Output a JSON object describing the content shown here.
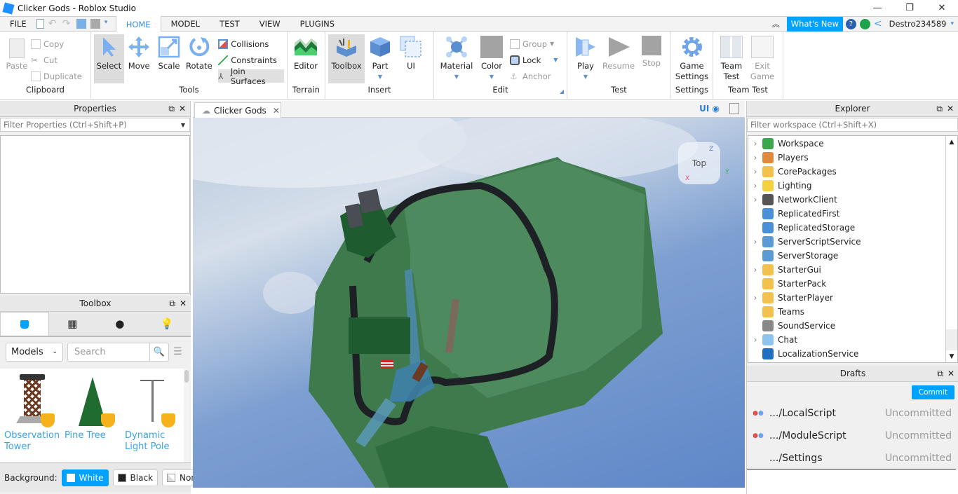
{
  "window": {
    "title": "Clicker Gods - Roblox Studio",
    "controls": [
      "—",
      "❐",
      "✕"
    ]
  },
  "menu": {
    "file": "FILE",
    "tabs": [
      "HOME",
      "MODEL",
      "TEST",
      "VIEW",
      "PLUGINS"
    ],
    "active_tab": "HOME",
    "whats_new": "What's New",
    "username": "Destro234589"
  },
  "ribbon": {
    "clipboard": {
      "label": "Clipboard",
      "paste": "Paste",
      "copy": "Copy",
      "cut": "Cut",
      "duplicate": "Duplicate"
    },
    "tools": {
      "label": "Tools",
      "select": "Select",
      "move": "Move",
      "scale": "Scale",
      "rotate": "Rotate",
      "collisions": "Collisions",
      "constraints": "Constraints",
      "join_surfaces": "Join Surfaces"
    },
    "terrain": {
      "label": "Terrain",
      "editor": "Editor"
    },
    "insert": {
      "label": "Insert",
      "toolbox": "Toolbox",
      "part": "Part",
      "ui": "UI"
    },
    "edit": {
      "label": "Edit",
      "material": "Material",
      "color": "Color",
      "group": "Group",
      "lock": "Lock",
      "anchor": "Anchor"
    },
    "test": {
      "label": "Test",
      "play": "Play",
      "resume": "Resume",
      "stop": "Stop"
    },
    "settings": {
      "label": "Settings",
      "game_settings_1": "Game",
      "game_settings_2": "Settings"
    },
    "team_test": {
      "label": "Team Test",
      "team_test_1": "Team",
      "team_test_2": "Test",
      "exit_1": "Exit",
      "exit_2": "Game"
    }
  },
  "properties": {
    "title": "Properties",
    "filter_placeholder": "Filter Properties (Ctrl+Shift+P)"
  },
  "toolbox": {
    "title": "Toolbox",
    "category": "Models",
    "search_placeholder": "Search",
    "assets": [
      {
        "name": "Observation Tower"
      },
      {
        "name": "Pine Tree"
      },
      {
        "name": "Dynamic Light Pole"
      }
    ],
    "background_label": "Background:",
    "backgrounds": [
      "White",
      "Black",
      "None"
    ],
    "selected_background": "White"
  },
  "viewport": {
    "tab_title": "Clicker Gods",
    "ui_toggle": "UI",
    "view_cube": "Top",
    "axis_labels": [
      "X",
      "Y",
      "Z"
    ]
  },
  "explorer": {
    "title": "Explorer",
    "filter_placeholder": "Filter workspace (Ctrl+Shift+X)",
    "items": [
      {
        "name": "Workspace",
        "expandable": true,
        "icon": "globe-icon",
        "color": "#3aa84a"
      },
      {
        "name": "Players",
        "expandable": true,
        "icon": "players-icon",
        "color": "#e08a3c"
      },
      {
        "name": "CorePackages",
        "expandable": true,
        "icon": "folder-icon",
        "color": "#f2c14e"
      },
      {
        "name": "Lighting",
        "expandable": true,
        "icon": "lightbulb-icon",
        "color": "#f5d142"
      },
      {
        "name": "NetworkClient",
        "expandable": true,
        "icon": "network-icon",
        "color": "#555555"
      },
      {
        "name": "ReplicatedFirst",
        "expandable": false,
        "icon": "replicated-icon",
        "color": "#4a90d9"
      },
      {
        "name": "ReplicatedStorage",
        "expandable": false,
        "icon": "replicated-icon",
        "color": "#4a90d9"
      },
      {
        "name": "ServerScriptService",
        "expandable": true,
        "icon": "server-script-icon",
        "color": "#5b9bd5"
      },
      {
        "name": "ServerStorage",
        "expandable": false,
        "icon": "server-storage-icon",
        "color": "#5b9bd5"
      },
      {
        "name": "StarterGui",
        "expandable": true,
        "icon": "folder-gui-icon",
        "color": "#f2c14e"
      },
      {
        "name": "StarterPack",
        "expandable": false,
        "icon": "folder-icon",
        "color": "#f2c14e"
      },
      {
        "name": "StarterPlayer",
        "expandable": true,
        "icon": "folder-player-icon",
        "color": "#f2c14e"
      },
      {
        "name": "Teams",
        "expandable": false,
        "icon": "folder-teams-icon",
        "color": "#f2c14e"
      },
      {
        "name": "SoundService",
        "expandable": false,
        "icon": "speaker-icon",
        "color": "#888888"
      },
      {
        "name": "Chat",
        "expandable": true,
        "icon": "chat-icon",
        "color": "#8ec5f0"
      },
      {
        "name": "LocalizationService",
        "expandable": false,
        "icon": "localization-icon",
        "color": "#1e6fc2"
      }
    ]
  },
  "drafts": {
    "title": "Drafts",
    "commit": "Commit",
    "items": [
      {
        "name": ".../LocalScript",
        "status": "Uncommitted",
        "has_icon": true
      },
      {
        "name": ".../ModuleScript",
        "status": "Uncommitted",
        "has_icon": true
      },
      {
        "name": ".../Settings",
        "status": "Uncommitted",
        "has_icon": false
      }
    ]
  }
}
